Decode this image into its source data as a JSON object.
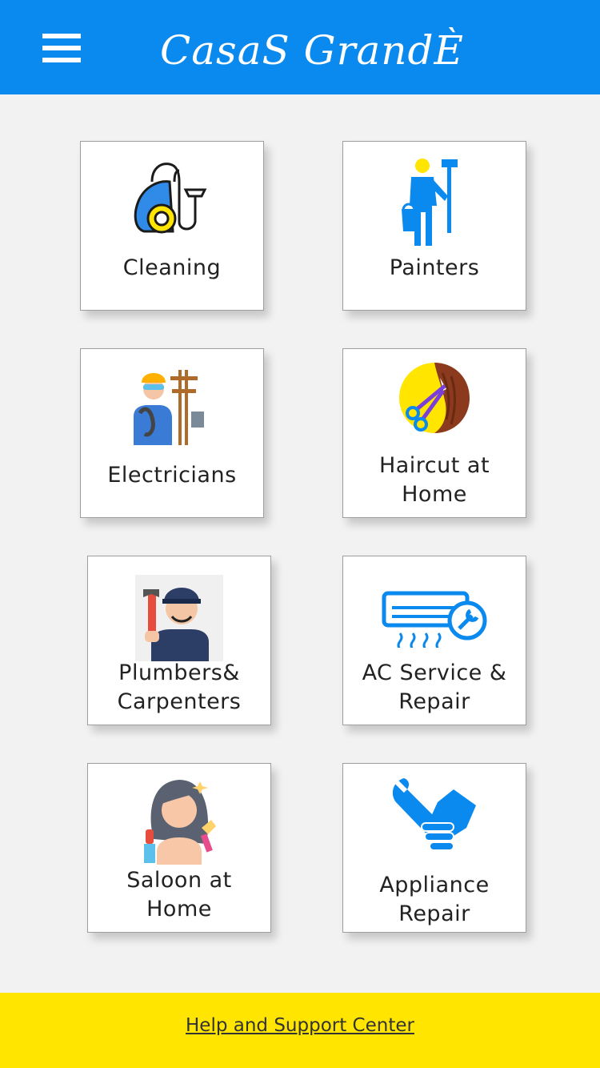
{
  "header": {
    "title": "CasaS GrandÈ",
    "menu_icon": "hamburger-menu-icon",
    "background": "#0a89ee"
  },
  "services": [
    {
      "label": "Cleaning",
      "icon": "vacuum-cleaner-icon"
    },
    {
      "label": "Painters",
      "icon": "painter-icon"
    },
    {
      "label": "Electricians",
      "icon": "electrician-icon"
    },
    {
      "label_line1": "Haircut at",
      "label_line2": "Home",
      "icon": "scissors-hair-icon"
    },
    {
      "label_line1": "Plumbers&",
      "label_line2": "Carpenters",
      "icon": "plumber-icon"
    },
    {
      "label_line1": "AC Service &",
      "label_line2": "Repair",
      "icon": "air-conditioner-icon"
    },
    {
      "label_line1": "Saloon at",
      "label_line2": "Home",
      "icon": "salon-woman-icon"
    },
    {
      "label_line1": "Appliance",
      "label_line2": "Repair",
      "icon": "wrench-hand-icon"
    }
  ],
  "footer": {
    "help_link": "Help and Support Center",
    "background": "#ffe500"
  }
}
